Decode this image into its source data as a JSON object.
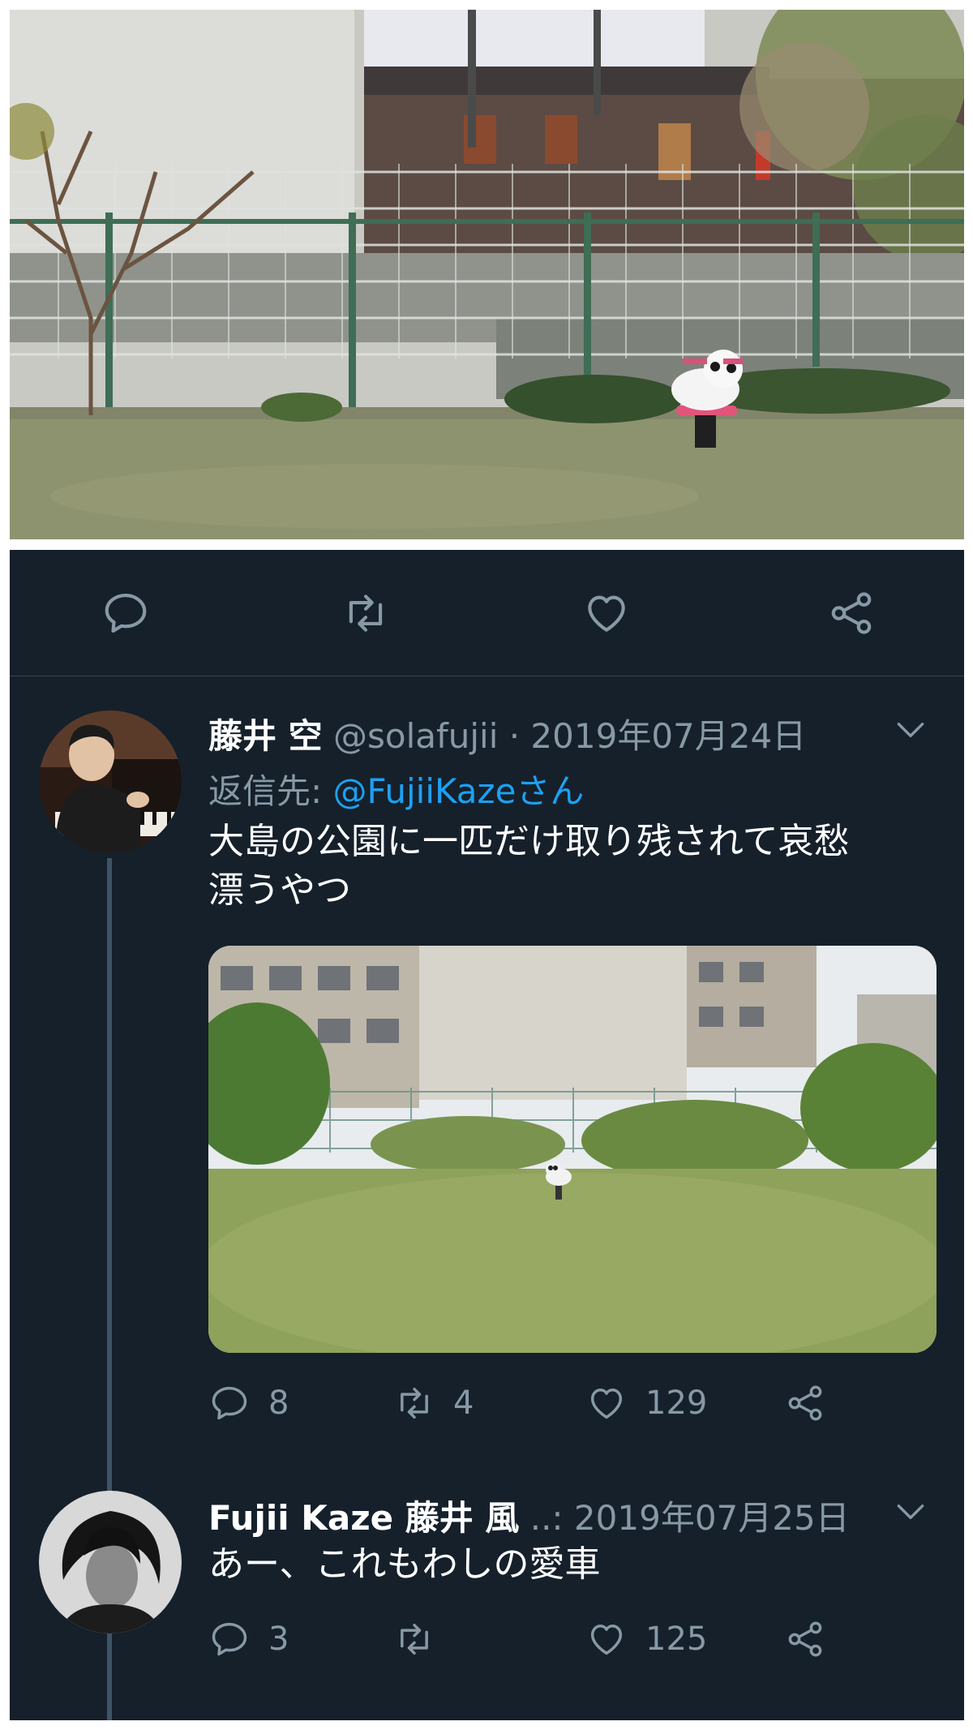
{
  "thread": {
    "tweets": [
      {
        "name": "藤井 空",
        "meta": "@solafujii · 2019年07月24日",
        "reply_label": "返信先:",
        "reply_handle": "@FujiiKazeさん",
        "text_line1": "大島の公園に一匹だけ取り残されて哀愁",
        "text_line2": "漂うやつ",
        "reply_count": "8",
        "retweet_count": "4",
        "like_count": "129"
      },
      {
        "name": "Fujii Kaze 藤井 風",
        "meta": " ..: 2019年07月25日",
        "text_line1": "あー、これもわしの愛車",
        "reply_count": "3",
        "retweet_count": "",
        "like_count": "125"
      }
    ]
  },
  "icons": {
    "action_bar": [
      "reply-icon",
      "retweet-icon",
      "like-icon",
      "share-icon"
    ],
    "caret": "chevron-down-icon"
  },
  "colors": {
    "background": "#15202b",
    "secondary_text": "#8899a6",
    "link": "#1da1f2",
    "thread_line": "#3d5466"
  }
}
